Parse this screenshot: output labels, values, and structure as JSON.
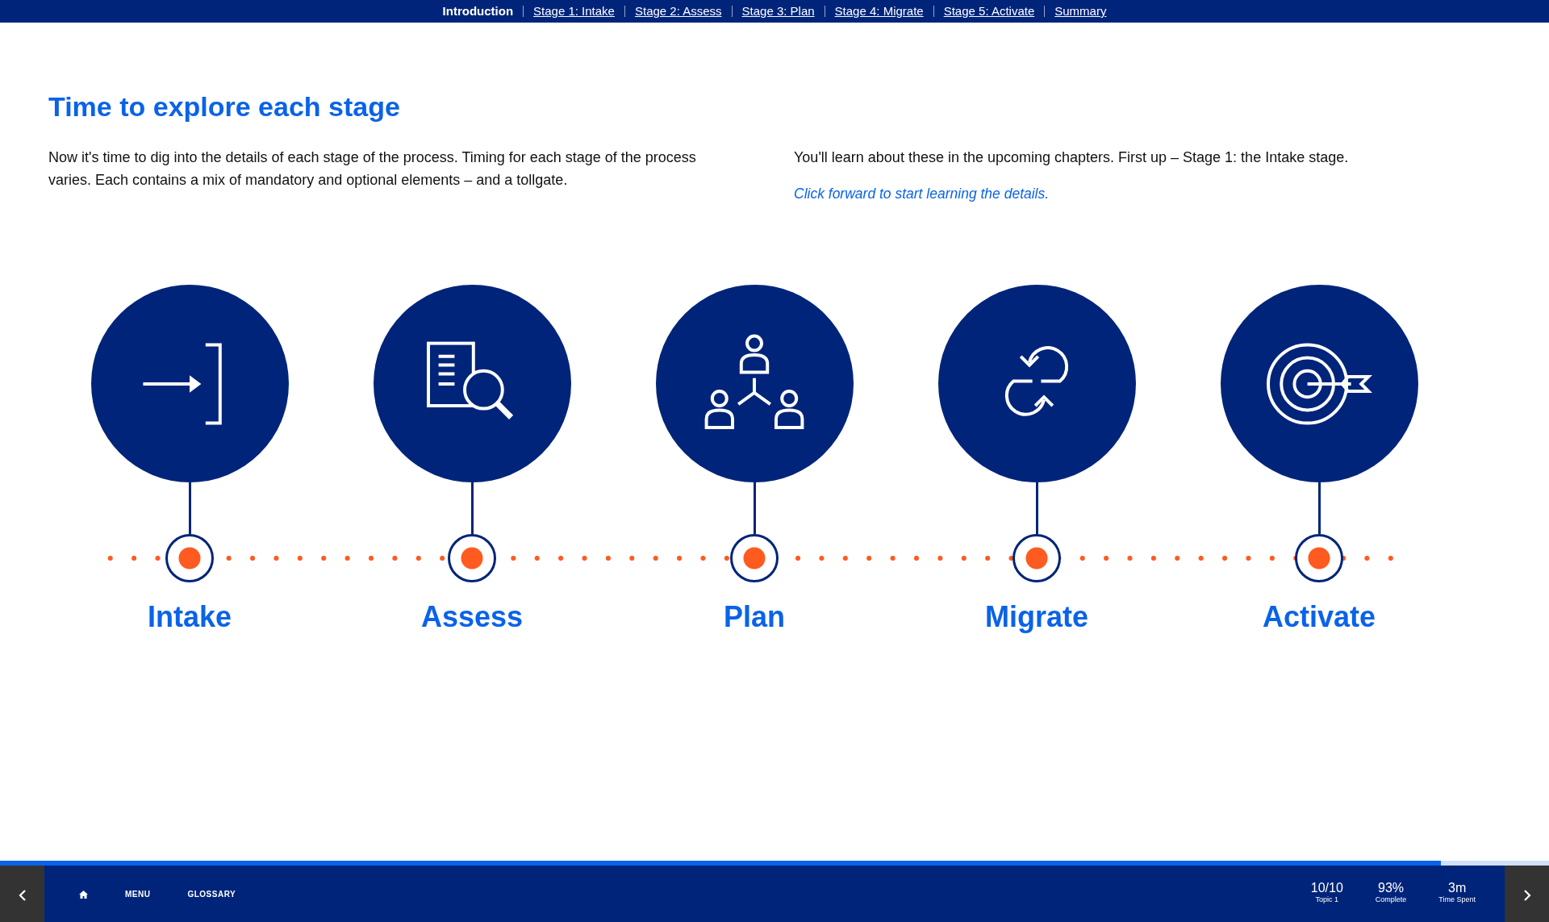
{
  "nav": [
    {
      "label": "Introduction",
      "selected": true
    },
    {
      "label": "Stage 1: Intake",
      "selected": false
    },
    {
      "label": "Stage 2: Assess",
      "selected": false
    },
    {
      "label": "Stage 3: Plan",
      "selected": false
    },
    {
      "label": "Stage 4: Migrate",
      "selected": false
    },
    {
      "label": "Stage 5: Activate",
      "selected": false
    },
    {
      "label": "Summary",
      "selected": false
    }
  ],
  "heading": "Time to explore each stage",
  "intro": "Now it's time to dig into the details of each stage of the process. Timing for each stage of the process varies. Each contains a mix of mandatory and optional elements – and a tollgate.",
  "note": "You'll learn about these in the upcoming chapters. First up – Stage 1: the Intake stage.",
  "instruction": "Click forward to start learning the details.",
  "stages": [
    {
      "label": "Intake",
      "kind": "enter"
    },
    {
      "label": "Assess",
      "kind": "search"
    },
    {
      "label": "Plan",
      "kind": "team"
    },
    {
      "label": "Migrate",
      "kind": "loop"
    },
    {
      "label": "Activate",
      "kind": "target"
    }
  ],
  "progress": {
    "level": 0.93
  },
  "footer": {
    "links": [
      "MENU",
      "GLOSSARY"
    ],
    "stats": [
      {
        "value": "10/10",
        "label": "Topic 1"
      },
      {
        "value": "93%",
        "label": "Complete"
      },
      {
        "value": "3m",
        "label": "Time Spent"
      }
    ]
  }
}
